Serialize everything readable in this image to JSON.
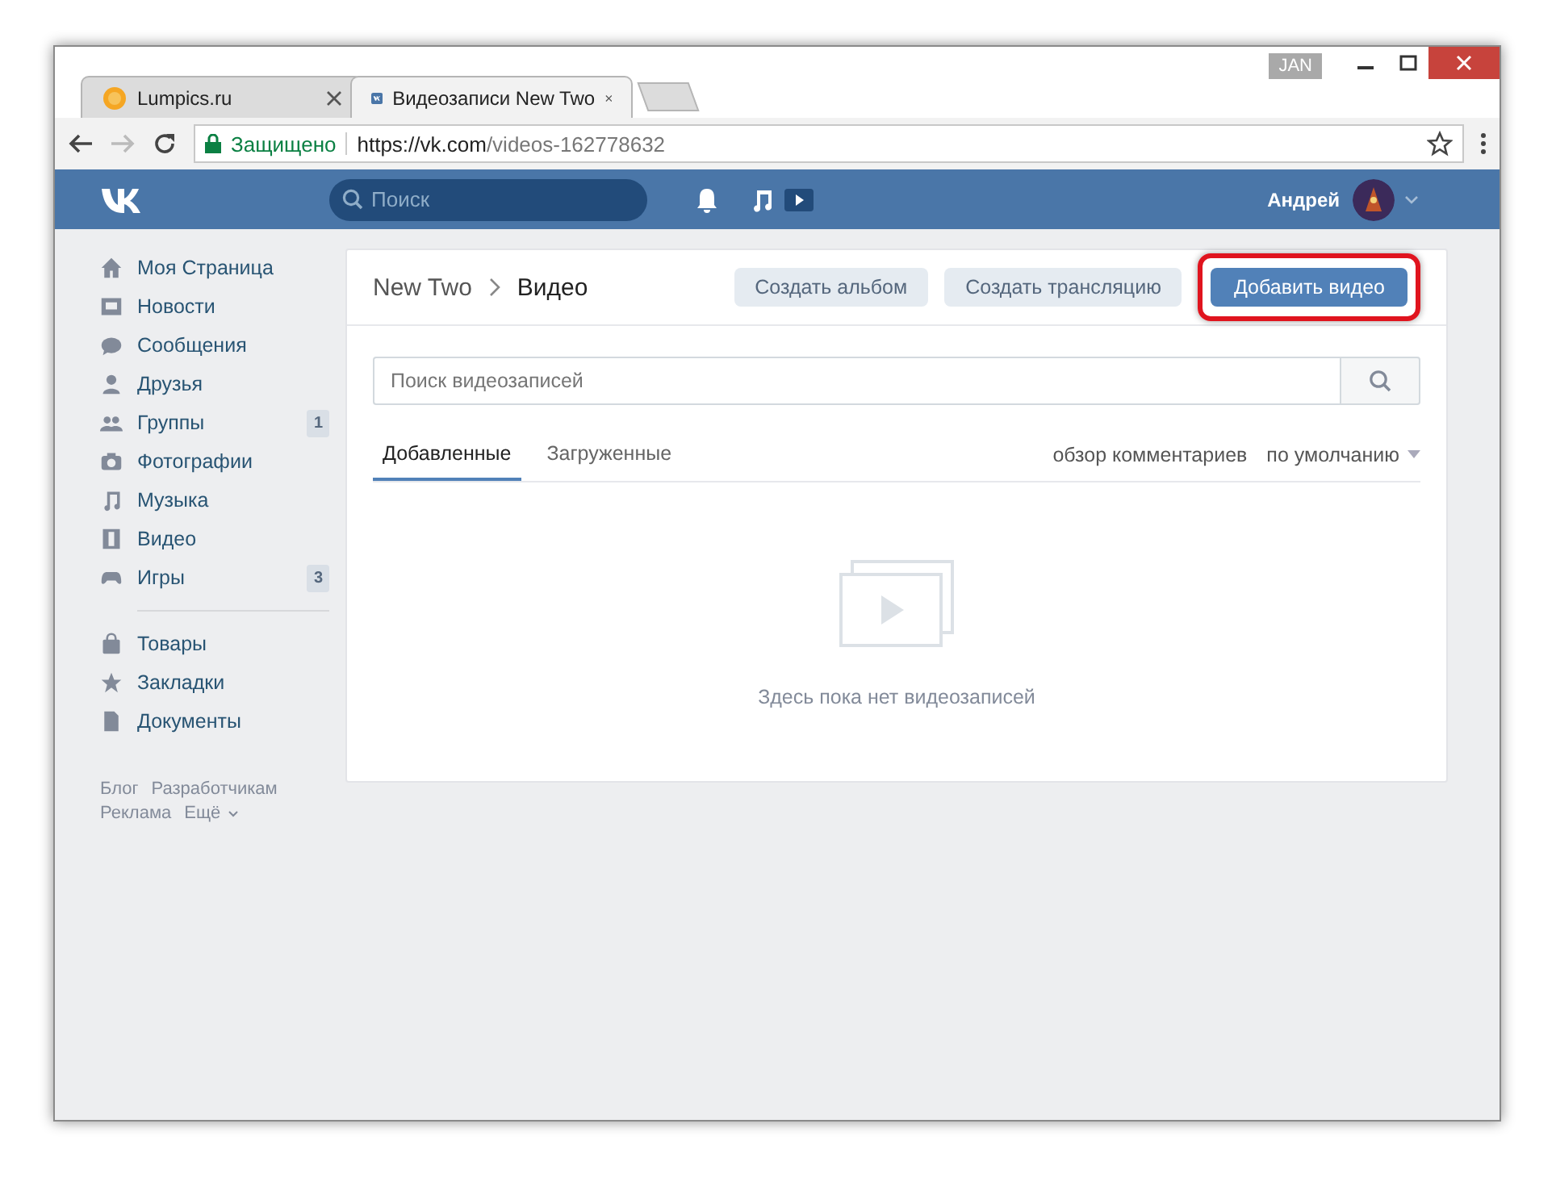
{
  "browser": {
    "tabs": [
      {
        "title": "Lumpics.ru",
        "selected": false
      },
      {
        "title": "Видеозаписи New Two",
        "selected": true
      }
    ],
    "badge": "JAN",
    "secure_label": "Защищено",
    "url_host": "https://vk.com",
    "url_path": "/videos-162778632"
  },
  "header": {
    "search": {
      "placeholder": "Поиск"
    },
    "user": "Андрей"
  },
  "sidebar": {
    "items": [
      {
        "label": "Моя Страница"
      },
      {
        "label": "Новости"
      },
      {
        "label": "Сообщения"
      },
      {
        "label": "Друзья"
      },
      {
        "label": "Группы",
        "count": "1"
      },
      {
        "label": "Фотографии"
      },
      {
        "label": "Музыка"
      },
      {
        "label": "Видео"
      },
      {
        "label": "Игры",
        "count": "3"
      }
    ],
    "items_2": [
      {
        "label": "Товары"
      },
      {
        "label": "Закладки"
      },
      {
        "label": "Документы"
      }
    ],
    "footer_links": [
      [
        "Блог",
        "Разработчикам"
      ],
      [
        "Реклама",
        "Ещё"
      ]
    ]
  },
  "card": {
    "breadcrumb": [
      "New Two",
      "Видео"
    ],
    "buttons": [
      {
        "label": "Создать альбом",
        "kind": "secondary",
        "highlighted": false
      },
      {
        "label": "Создать трансляцию",
        "kind": "secondary",
        "highlighted": false
      },
      {
        "label": "Добавить видео",
        "kind": "primary",
        "highlighted": true
      }
    ],
    "search": {
      "placeholder": "Поиск видеозаписей"
    },
    "tabs": [
      {
        "label": "Добавленные",
        "selected": true
      },
      {
        "label": "Загруженные",
        "selected": false
      }
    ],
    "comments_link": "обзор комментариев",
    "sort": "по умолчанию",
    "empty_text": "Здесь пока нет видеозаписей"
  }
}
